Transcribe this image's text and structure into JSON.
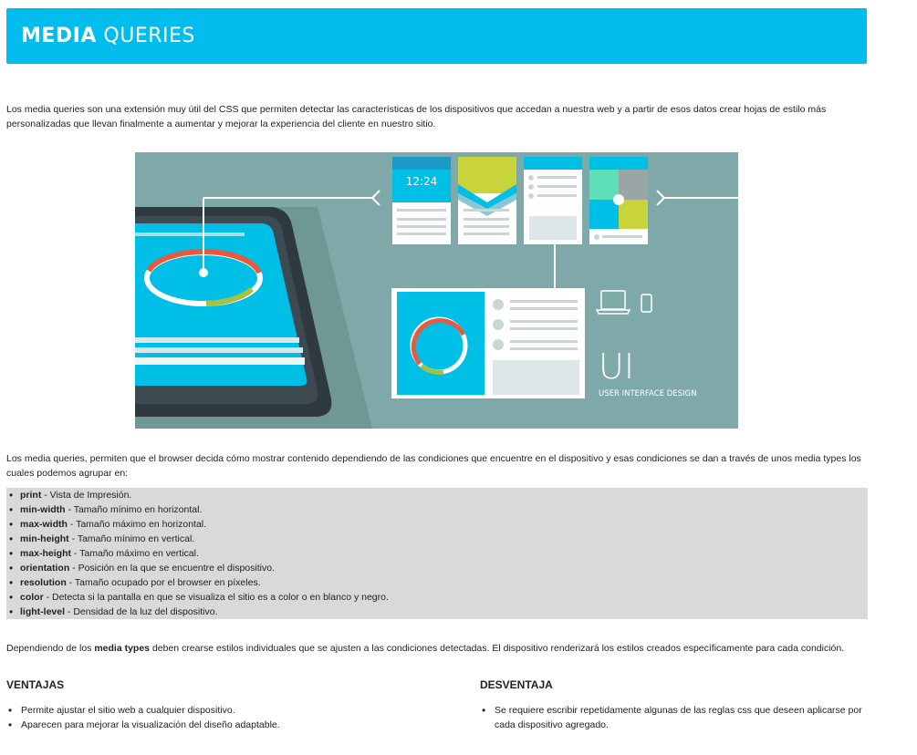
{
  "header": {
    "title_bold": "MEDIA",
    "title_rest": " QUERIES"
  },
  "intro": "Los media queries son una extensión muy útil del CSS que permiten detectar las características de los dispositivos que accedan a nuestra web y a partir de esos datos crear hojas de estilo más personalizadas que llevan finalmente a aumentar y mejorar la experiencia del cliente en nuestro sitio.",
  "hero": {
    "clock": "12:24",
    "ui_big": "UI",
    "ui_sub": "USER INTERFACE DESIGN",
    "colors": {
      "bg": "#7fa9a8",
      "cyan": "#00bfe6",
      "red": "#e8593d",
      "green": "#a5c13e",
      "yellow": "#c9d43a"
    }
  },
  "explanation": "Los media queries, permiten que el browser decida cómo mostrar contenido dependiendo de las condiciones que encuentre en el dispositivo y esas condiciones se dan a través de unos media types los cuales podemos agrupar en:",
  "media_types": [
    {
      "name": "print",
      "desc": " - Vista de Impresión."
    },
    {
      "name": "min-width",
      "desc": " - Tamaño mínimo en horizontal."
    },
    {
      "name": "max-width",
      "desc": " - Tamaño máximo en horizontal."
    },
    {
      "name": "min-height",
      "desc": " - Tamaño mínimo en vertical."
    },
    {
      "name": "max-height",
      "desc": " - Tamaño máximo en vertical."
    },
    {
      "name": "orientation",
      "desc": " - Posición en la que se encuentre el dispositivo."
    },
    {
      "name": "resolution",
      "desc": " - Tamaño ocupado por el browser en píxeles."
    },
    {
      "name": "color",
      "desc": " - Detecta si la pantalla en que se visualiza el sitio es a color o en blanco y negro."
    },
    {
      "name": "light-level",
      "desc": " - Densidad de la luz del dispositivo."
    }
  ],
  "dependency": {
    "before": "Dependiendo de los ",
    "bold": "media types",
    "after": " deben crearse estilos individuales que se ajusten a las condiciones detectadas. El dispositivo renderizará los estilos creados específicamente para cada condición."
  },
  "ventajas": {
    "title": "VENTAJAS",
    "items": [
      "Permite ajustar el sitio web a cualquier dispositivo.",
      "Aparecen para mejorar la visualización del diseño adaptable."
    ]
  },
  "desventaja": {
    "title": "DESVENTAJA",
    "items": [
      "Se requiere escribir repetidamente algunas de las reglas css que deseen aplicarse por cada dispositivo agregado."
    ]
  }
}
